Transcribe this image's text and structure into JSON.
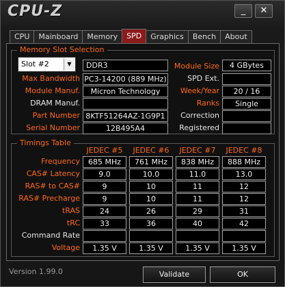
{
  "app": {
    "title": "CPU-Z",
    "minimize": "_",
    "close": "✕"
  },
  "tabs": [
    {
      "label": "CPU"
    },
    {
      "label": "Mainboard"
    },
    {
      "label": "Memory"
    },
    {
      "label": "SPD"
    },
    {
      "label": "Graphics"
    },
    {
      "label": "Bench"
    },
    {
      "label": "About"
    }
  ],
  "active_tab": "SPD",
  "slot": {
    "group_title": "Memory Slot Selection",
    "selected_slot": "Slot #2",
    "type": "DDR3",
    "labels": {
      "max_bandwidth": "Max Bandwidth",
      "module_manuf": "Module Manuf.",
      "dram_manuf": "DRAM Manuf.",
      "part_number": "Part Number",
      "serial_number": "Serial Number",
      "module_size": "Module Size",
      "spd_ext": "SPD Ext.",
      "week_year": "Week/Year",
      "ranks": "Ranks",
      "correction": "Correction",
      "registered": "Registered"
    },
    "values": {
      "max_bandwidth": "PC3-14200 (889 MHz)",
      "module_manuf": "Micron Technology",
      "dram_manuf": "",
      "part_number": "8KTF51264AZ-1G9P1",
      "serial_number": "12B495A4",
      "module_size": "4 GBytes",
      "spd_ext": "",
      "week_year": "20 / 16",
      "ranks": "Single",
      "correction": "",
      "registered": ""
    }
  },
  "timings": {
    "group_title": "Timings Table",
    "columns": [
      "JEDEC #5",
      "JEDEC #6",
      "JEDEC #7",
      "JEDEC #8"
    ],
    "rows": [
      {
        "label": "Frequency",
        "values": [
          "685 MHz",
          "761 MHz",
          "838 MHz",
          "888 MHz"
        ]
      },
      {
        "label": "CAS# Latency",
        "values": [
          "9.0",
          "10.0",
          "11.0",
          "13.0"
        ]
      },
      {
        "label": "RAS# to CAS#",
        "values": [
          "9",
          "10",
          "11",
          "12"
        ]
      },
      {
        "label": "RAS# Precharge",
        "values": [
          "9",
          "10",
          "11",
          "12"
        ]
      },
      {
        "label": "tRAS",
        "values": [
          "24",
          "26",
          "29",
          "31"
        ]
      },
      {
        "label": "tRC",
        "values": [
          "33",
          "36",
          "40",
          "42"
        ]
      },
      {
        "label": "Command Rate",
        "values": [
          "",
          "",
          "",
          ""
        ]
      },
      {
        "label": "Voltage",
        "values": [
          "1.35 V",
          "1.35 V",
          "1.35 V",
          "1.35 V"
        ]
      }
    ]
  },
  "footer": {
    "version": "Version 1.99.0",
    "validate": "Validate",
    "ok": "OK"
  },
  "colors": {
    "accent_orange": "#ff6a1a",
    "active_tab": "#8b1a1a",
    "background": "#111111"
  }
}
